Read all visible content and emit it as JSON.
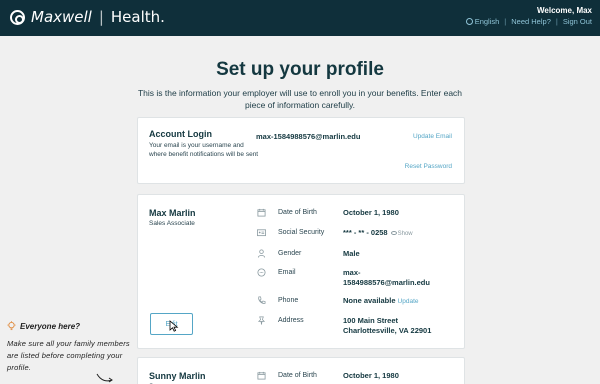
{
  "header": {
    "brand": "Maxwell",
    "divider": "|",
    "brand_suffix": "Health.",
    "welcome": "Welcome, Max",
    "language": "English",
    "help": "Need Help?",
    "sign_out": "Sign Out",
    "link_separator": "|"
  },
  "page": {
    "title": "Set up your profile",
    "subtitle": "This is the information your employer will use to enroll you in your benefits. Enter each piece of information carefully."
  },
  "account": {
    "title": "Account Login",
    "description": "Your email is your username and where benefit notifications will be sent",
    "email": "max-1584988576@marlin.edu",
    "update_email": "Update Email",
    "reset_password": "Reset Password"
  },
  "person": {
    "name": "Max Marlin",
    "role": "Sales Associate",
    "edit_label": "Edit",
    "fields": [
      {
        "icon": "calendar-icon",
        "label": "Date of Birth",
        "value": "October 1, 1980"
      },
      {
        "icon": "id-card-icon",
        "label": "Social Security",
        "value": "*** - ** - 0258",
        "extra": "Show"
      },
      {
        "icon": "person-icon",
        "label": "Gender",
        "value": "Male"
      },
      {
        "icon": "chat-icon",
        "label": "Email",
        "value": "max-\n1584988576@marlin.edu"
      },
      {
        "icon": "phone-icon",
        "label": "Phone",
        "value": "None available",
        "extra": "Update"
      },
      {
        "icon": "pin-icon",
        "label": "Address",
        "value": "100 Main Street\nCharlottesville, VA 22901"
      }
    ]
  },
  "person2": {
    "name": "Sunny Marlin",
    "role": "S",
    "fields": [
      {
        "icon": "calendar-icon",
        "label": "Date of Birth",
        "value": "October 1, 1980"
      }
    ]
  },
  "note": {
    "title": "Everyone here?",
    "body": "Make sure all your family members are listed before completing your profile."
  },
  "colors": {
    "header_bg": "#0f2f3a",
    "link": "#55a6c6",
    "text_dark": "#143840",
    "page_bg": "#f0f0f0"
  }
}
